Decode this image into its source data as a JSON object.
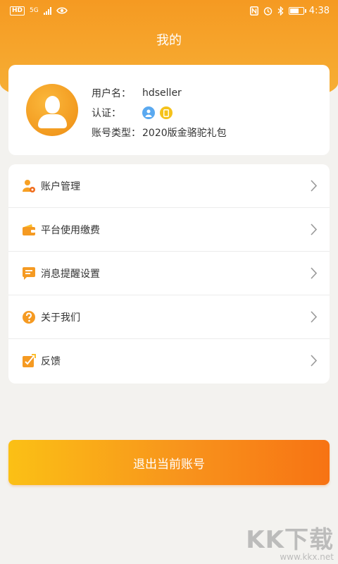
{
  "status_bar": {
    "hd_label": "HD",
    "network_label": "5G",
    "time": "4:38"
  },
  "header": {
    "title": "我的"
  },
  "profile": {
    "username_label": "用户名：",
    "username": "hdseller",
    "auth_label": "认证：",
    "account_type_label": "账号类型：",
    "account_type": "2020版金骆驼礼包"
  },
  "menu": {
    "items": [
      {
        "label": "账户管理",
        "icon": "account-manage-icon"
      },
      {
        "label": "平台使用缴费",
        "icon": "wallet-icon"
      },
      {
        "label": "消息提醒设置",
        "icon": "message-icon"
      },
      {
        "label": "关于我们",
        "icon": "question-icon"
      },
      {
        "label": "反馈",
        "icon": "feedback-icon"
      }
    ]
  },
  "logout_label": "退出当前账号",
  "watermark": {
    "big": "KK下载",
    "small": "www.kkx.net"
  },
  "colors": {
    "accent": "#f59a22",
    "logout_start": "#fbc015",
    "logout_end": "#f77313",
    "badge_user": "#5aa9f0",
    "badge_phone": "#f5c21b"
  }
}
